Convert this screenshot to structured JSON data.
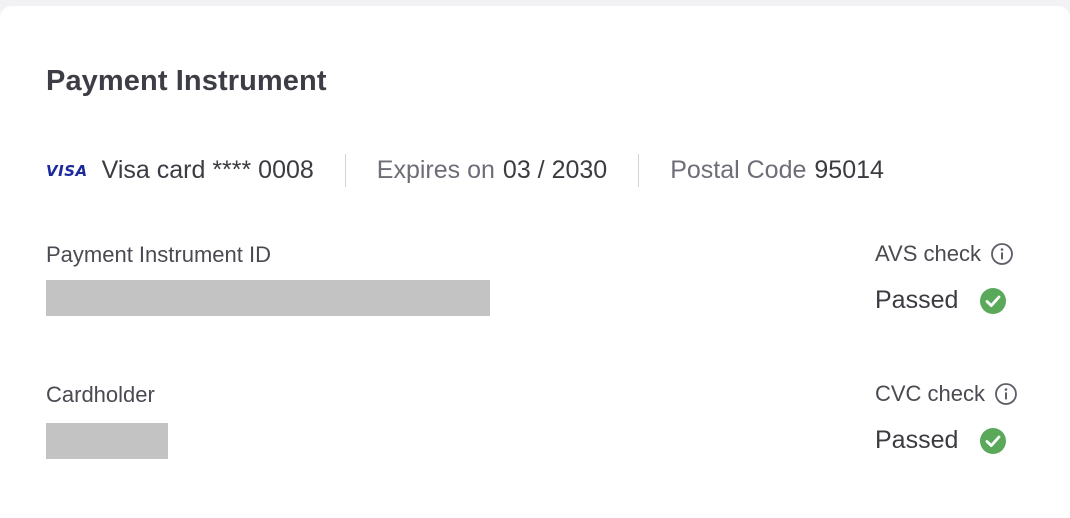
{
  "card": {
    "title": "Payment Instrument"
  },
  "summary": {
    "brand_logo": "VISA",
    "brand_logo_color": "#1a2a9c",
    "card_label": "Visa card **** 0008",
    "expiry_label": "Expires on",
    "expiry_value": "03 / 2030",
    "postal_label": "Postal Code",
    "postal_value": "95014"
  },
  "fields": {
    "instrument_id_label": "Payment Instrument ID",
    "cardholder_label": "Cardholder"
  },
  "checks": {
    "avs_label": "AVS check",
    "avs_status": "Passed",
    "cvc_label": "CVC check",
    "cvc_status": "Passed",
    "info_icon": "info-circle-icon",
    "status_icon": "check-circle-icon",
    "passed_color": "#5aa85a"
  }
}
